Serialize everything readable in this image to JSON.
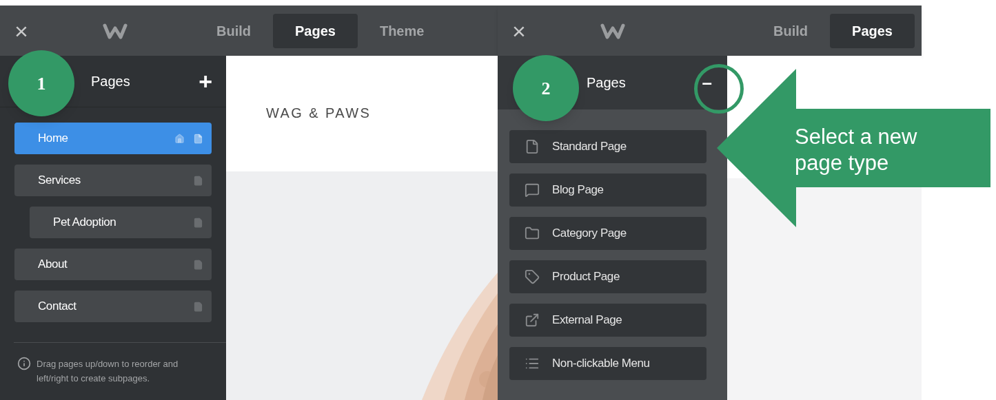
{
  "screens": [
    {
      "kind": "page_list",
      "badge": "1",
      "top_bar": {
        "close": "×",
        "tabs": [
          {
            "label": "Build",
            "selected": false
          },
          {
            "label": "Pages",
            "selected": true
          },
          {
            "label": "Theme",
            "selected": false
          }
        ]
      },
      "sidebar": {
        "title": "Pages",
        "action": "+",
        "pages": [
          {
            "label": "Home",
            "selected": true,
            "is_home": true
          },
          {
            "label": "Services",
            "selected": false,
            "is_home": false,
            "children": [
              {
                "label": "Pet Adoption",
                "selected": false,
                "is_home": false
              }
            ]
          },
          {
            "label": "About",
            "selected": false,
            "is_home": false
          },
          {
            "label": "Contact",
            "selected": false,
            "is_home": false
          }
        ],
        "hint": "Drag pages up/down to reorder and left/right to create subpages."
      },
      "preview": {
        "site_title": "WAG & PAWS"
      }
    },
    {
      "kind": "page_types",
      "badge": "2",
      "top_bar": {
        "close": "×",
        "tabs": [
          {
            "label": "Build",
            "selected": false
          },
          {
            "label": "Pages",
            "selected": true
          }
        ]
      },
      "sidebar": {
        "title": "Pages",
        "action": "–",
        "action_highlighted": true,
        "page_types": [
          {
            "kind": "standard",
            "label": "Standard Page"
          },
          {
            "kind": "blog",
            "label": "Blog Page"
          },
          {
            "kind": "category",
            "label": "Category Page"
          },
          {
            "kind": "product",
            "label": "Product Page"
          },
          {
            "kind": "external",
            "label": "External Page"
          },
          {
            "kind": "menu",
            "label": "Non-clickable Menu"
          }
        ]
      }
    }
  ],
  "callout": {
    "text": "Select a new page type"
  }
}
